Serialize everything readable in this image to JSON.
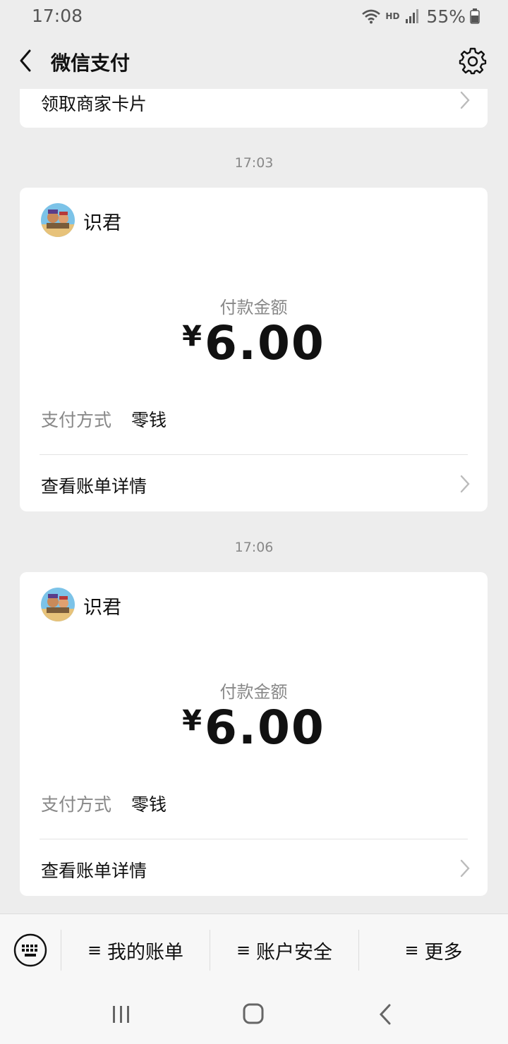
{
  "status": {
    "time": "17:08",
    "network_badge": "HD",
    "battery": "55%",
    "icons": [
      "wifi-icon",
      "signal-icon",
      "battery-icon"
    ]
  },
  "nav": {
    "title": "微信支付",
    "back_icon": "chevron-left-icon",
    "settings_icon": "gear-icon"
  },
  "top_card": {
    "label": "领取商家卡片"
  },
  "messages": [
    {
      "time": "17:03",
      "merchant": "识君",
      "pay_label": "付款金额",
      "currency": "¥",
      "amount": "6.00",
      "method_label": "支付方式",
      "method_value": "零钱",
      "detail_link": "查看账单详情"
    },
    {
      "time": "17:06",
      "merchant": "识君",
      "pay_label": "付款金额",
      "currency": "¥",
      "amount": "6.00",
      "method_label": "支付方式",
      "method_value": "零钱",
      "detail_link": "查看账单详情"
    }
  ],
  "bottom_menu": {
    "keyboard_icon": "keyboard-icon",
    "items": [
      {
        "mark": "≡",
        "label": "我的账单"
      },
      {
        "mark": "≡",
        "label": "账户安全"
      },
      {
        "mark": "≡",
        "label": "更多"
      }
    ]
  },
  "colors": {
    "background": "#ededed",
    "card": "#ffffff",
    "muted_text": "#888888",
    "primary_text": "#111111"
  }
}
